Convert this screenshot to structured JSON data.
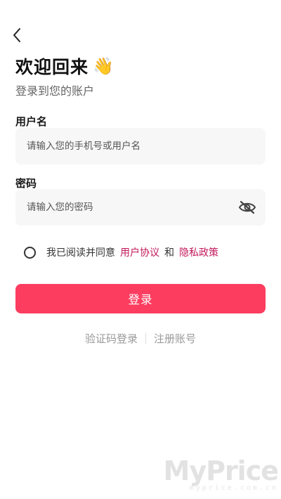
{
  "header": {
    "back_icon": "chevron-left-icon",
    "title": "欢迎回来",
    "title_emoji": "👋",
    "subtitle": "登录到您的账户"
  },
  "form": {
    "username_label": "用户名",
    "username_placeholder": "请输入您的手机号或用户名",
    "password_label": "密码",
    "password_placeholder": "请输入您的密码",
    "password_toggle_icon": "eye-off-icon"
  },
  "agreement": {
    "prefix": "我已阅读并同意",
    "user_agreement": "用户协议",
    "conjunction": "和",
    "privacy_policy": "隐私政策",
    "checked": false
  },
  "actions": {
    "login_label": "登录",
    "sms_login_label": "验证码登录",
    "register_label": "注册账号"
  },
  "watermark": {
    "logo": "MyPrice",
    "url": "myprice.com.cn"
  },
  "colors": {
    "accent": "#fc3d60",
    "link": "#c2185b",
    "input_bg": "#f7f7f8",
    "muted_text": "#999999"
  }
}
